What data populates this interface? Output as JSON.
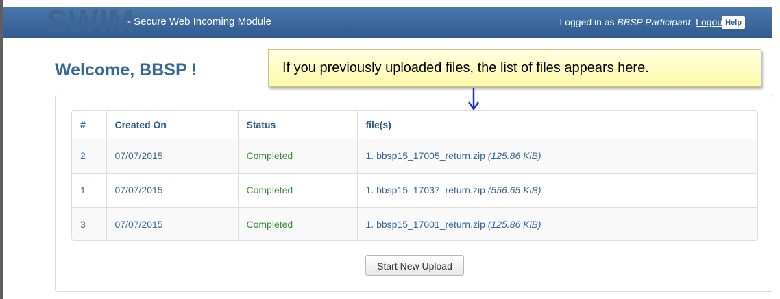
{
  "header": {
    "logo_text": "SWIM",
    "subtitle": "- Secure Web Incoming Module",
    "logged_in_prefix": "Logged in as ",
    "user_role": "BBSP Participant",
    "separator": ", ",
    "logout_label": "Logout",
    "help_label": "Help"
  },
  "page": {
    "welcome": "Welcome, BBSP !"
  },
  "callout": {
    "text": "If you previously uploaded files, the list of files appears here."
  },
  "table": {
    "headers": [
      "#",
      "Created On",
      "Status",
      "file(s)"
    ],
    "rows": [
      {
        "num": "2",
        "date": "07/07/2015",
        "status": "Completed",
        "file_index": "1.",
        "file_name": "bbsp15_17005_return.zip",
        "file_size": "(125.86 KiB)"
      },
      {
        "num": "1",
        "date": "07/07/2015",
        "status": "Completed",
        "file_index": "1.",
        "file_name": "bbsp15_17037_return.zip",
        "file_size": "(556.65 KiB)"
      },
      {
        "num": "3",
        "date": "07/07/2015",
        "status": "Completed",
        "file_index": "1.",
        "file_name": "bbsp15_17001_return.zip",
        "file_size": "(125.86 KiB)"
      }
    ]
  },
  "actions": {
    "start_upload_label": "Start New Upload"
  },
  "colors": {
    "navbar": "#2f5b8f",
    "accent": "#34659b",
    "status_completed": "#3c8a3c",
    "callout_bg": "#fdfaa8",
    "arrow": "#1f2fd6"
  }
}
